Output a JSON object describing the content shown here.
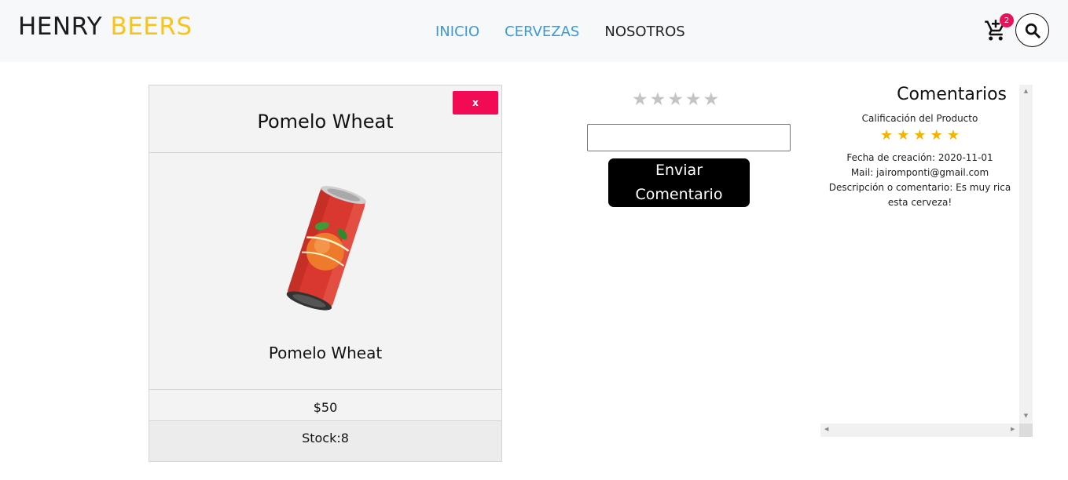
{
  "brand": {
    "part1": "HENRY",
    "part2": "BEERS"
  },
  "nav": {
    "inicio": "INICIO",
    "cervezas": "CERVEZAS",
    "nosotros": "NOSOTROS"
  },
  "cart": {
    "count": "2",
    "icon": "cart-plus-icon"
  },
  "search": {
    "icon": "search-icon"
  },
  "product": {
    "close_label": "x",
    "title": "Pomelo Wheat",
    "name": "Pomelo Wheat",
    "price": "$50",
    "stock": "Stock:8"
  },
  "review_form": {
    "stars_selected": 0,
    "stars_total": 5,
    "input_value": "",
    "send_line1": "Enviar",
    "send_line2": "Comentario"
  },
  "comments": {
    "title": "Comentarios",
    "rating_label": "Calificación del Producto",
    "rating_stars": 5,
    "items": [
      {
        "fecha": "Fecha de creación: 2020-11-01",
        "mail": "Mail: jairomponti@gmail.com",
        "desc_line1": "Descripción o comentario: Es muy rica",
        "desc_line2": "esta cerveza!"
      }
    ]
  },
  "colors": {
    "brand_accent": "#f7c41a",
    "nav_active": "#3a9ad9",
    "close_button": "#f30a55",
    "badge": "#e8115a",
    "gold_star": "#f5b301"
  }
}
